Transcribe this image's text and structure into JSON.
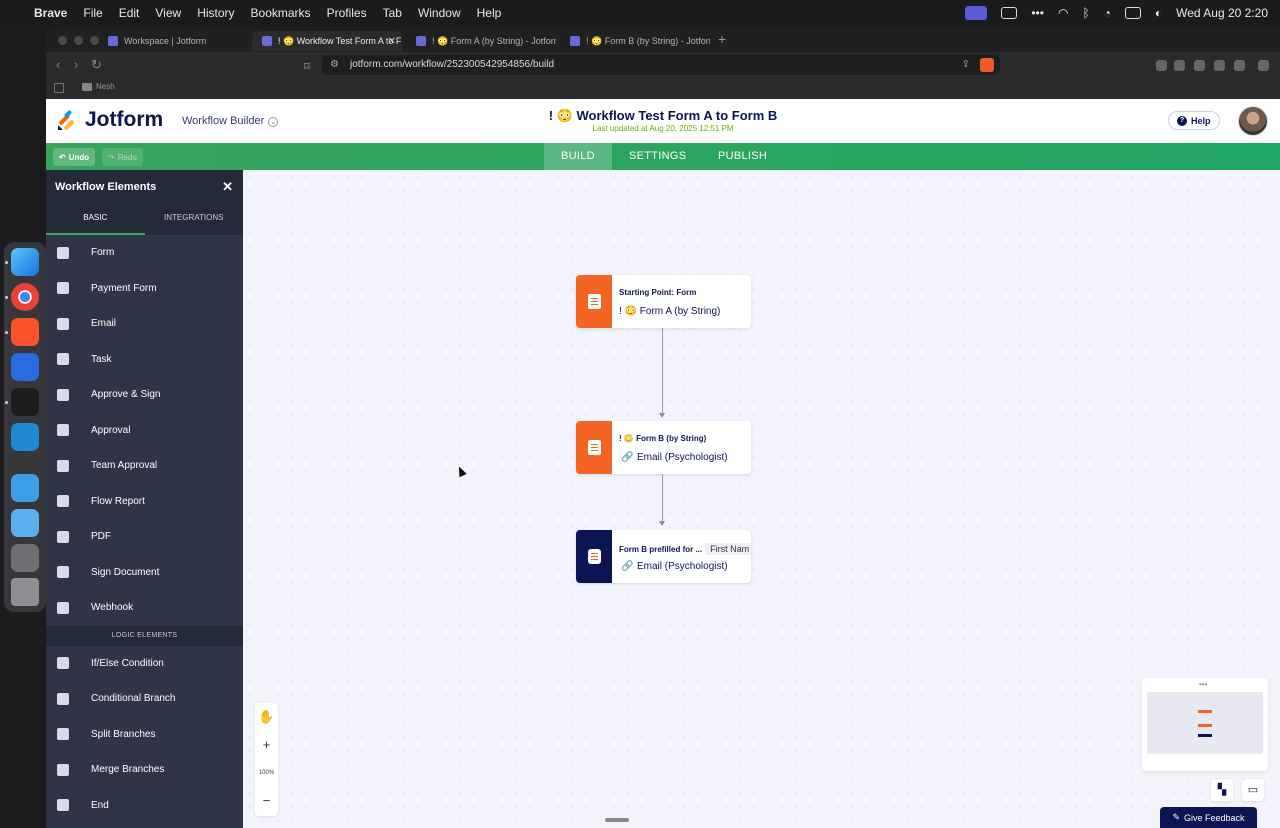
{
  "menubar": {
    "apple_glyph": "",
    "items": [
      "Brave",
      "File",
      "Edit",
      "View",
      "History",
      "Bookmarks",
      "Profiles",
      "Tab",
      "Window",
      "Help"
    ],
    "clock": "Wed Aug 20  2:20"
  },
  "browser": {
    "tabs": [
      {
        "label": "Workspace | Jotform"
      },
      {
        "label": "! 😳 Workflow Test Form A to F"
      },
      {
        "label": "! 😳 Form A (by String) - Jotform F"
      },
      {
        "label": "! 😳 Form B (by String) - Jotform F"
      }
    ],
    "url": "jotform.com/workflow/252300542954856/build",
    "bookmark_folder": "Nesh"
  },
  "header": {
    "logo_text": "Jotform",
    "builder_label": "Workflow Builder",
    "form_title": "! 😳 Workflow Test Form A to Form B",
    "subtitle": "Last updated at Aug 20, 2025 12:51 PM",
    "help_label": "Help"
  },
  "toolbar": {
    "undo": "Undo",
    "redo": "Redo",
    "tabs": [
      "BUILD",
      "SETTINGS",
      "PUBLISH"
    ],
    "active_tab": "BUILD"
  },
  "sidebar": {
    "title": "Workflow Elements",
    "tabs": [
      "BASIC",
      "INTEGRATIONS"
    ],
    "basic_items": [
      {
        "label": "Form",
        "icon": "form-icon"
      },
      {
        "label": "Payment Form",
        "icon": "payment-form-icon"
      },
      {
        "label": "Email",
        "icon": "email-icon"
      },
      {
        "label": "Task",
        "icon": "task-icon"
      },
      {
        "label": "Approve & Sign",
        "icon": "approve-sign-icon"
      },
      {
        "label": "Approval",
        "icon": "approval-icon"
      },
      {
        "label": "Team Approval",
        "icon": "team-approval-icon"
      },
      {
        "label": "Flow Report",
        "icon": "flow-report-icon"
      },
      {
        "label": "PDF",
        "icon": "pdf-icon"
      },
      {
        "label": "Sign Document",
        "icon": "sign-document-icon"
      },
      {
        "label": "Webhook",
        "icon": "webhook-icon"
      }
    ],
    "logic_section": "LOGIC ELEMENTS",
    "logic_items": [
      {
        "label": "If/Else Condition",
        "icon": "if-else-icon"
      },
      {
        "label": "Conditional Branch",
        "icon": "conditional-branch-icon"
      },
      {
        "label": "Split Branches",
        "icon": "split-branches-icon"
      },
      {
        "label": "Merge Branches",
        "icon": "merge-branches-icon"
      },
      {
        "label": "End",
        "icon": "end-icon"
      }
    ]
  },
  "canvas": {
    "nodes": [
      {
        "line1": "Starting Point: Form",
        "line2": "! 😳 Form A (by String)",
        "color": "#f26522"
      },
      {
        "line1": "! 😳 Form B (by String)",
        "line2": "Email (Psychologist)",
        "color": "#f26522"
      },
      {
        "line1": "Form B prefilled for ...",
        "chip": "First Nam",
        "line2": "Email (Psychologist)",
        "color": "#0a1551"
      }
    ],
    "zoom": "100%",
    "feedback": "Give Feedback"
  },
  "colors": {
    "accent_green": "#22a85f",
    "sidebar_bg": "#2f3547",
    "node_orange": "#f26522",
    "node_navy": "#0a1551"
  }
}
